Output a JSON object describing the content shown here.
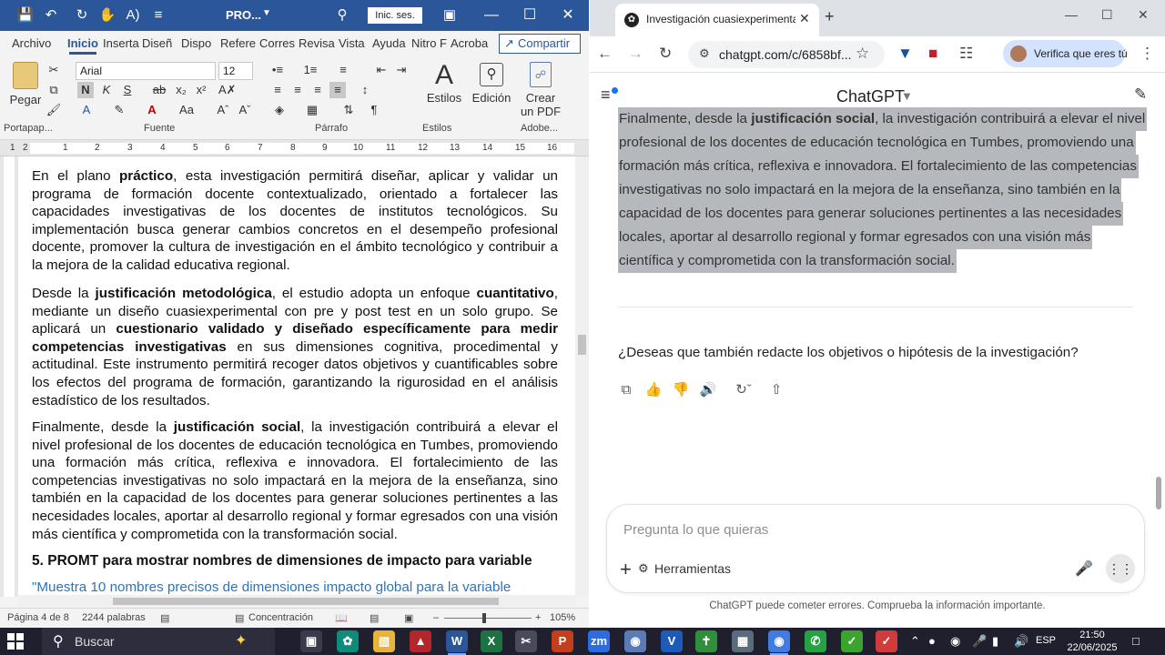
{
  "word": {
    "titlebar": {
      "doc_title": "PRO...",
      "signin_label": "Inic. ses."
    },
    "tabs": [
      "Archivo",
      "Inicio",
      "Inserta",
      "Diseñ",
      "Dispo",
      "Refere",
      "Corres",
      "Revisa",
      "Vista",
      "Ayuda",
      "Nitro F",
      "Acroba"
    ],
    "share_label": "Compartir",
    "ribbon": {
      "paste_label": "Pegar",
      "font_name": "Arial",
      "font_size": "12",
      "bold_glyph": "N",
      "italic_glyph": "K",
      "underline_glyph": "S",
      "styles_label": "Estilos",
      "editing_label": "Edición",
      "pdf_label_1": "Crear",
      "pdf_label_2": "un PDF",
      "groups": {
        "clipboard": "Portapap...",
        "font": "Fuente",
        "paragraph": "Párrafo",
        "styles": "Estilos",
        "adobe": "Adobe..."
      }
    },
    "ruler_numbers": [
      "1",
      "2",
      "1",
      "2",
      "3",
      "4",
      "5",
      "6",
      "7",
      "8",
      "9",
      "10",
      "11",
      "12",
      "13",
      "14",
      "15",
      "16"
    ],
    "document": {
      "p1": "En el plano <b>práctico</b>, esta investigación permitirá diseñar, aplicar y validar un programa de formación docente contextualizado, orientado a fortalecer las capacidades investigativas de los docentes de institutos tecnológicos. Su implementación busca generar cambios concretos en el desempeño profesional docente, promover la cultura de investigación en el ámbito tecnológico y contribuir a la mejora de la calidad educativa regional.",
      "p2": "Desde la <b>justificación metodológica</b>, el estudio adopta un enfoque <b>cuantitativo</b>, mediante un diseño cuasiexperimental con pre y post test en un solo grupo. Se aplicará un <b>cuestionario validado y diseñado específicamente para medir competencias investigativas</b> en sus dimensiones cognitiva, procedimental y actitudinal. Este instrumento permitirá recoger datos objetivos y cuantificables sobre los efectos del programa de formación, garantizando la rigurosidad en el análisis estadístico de los resultados.",
      "p3": "Finalmente, desde la <b>justificación social</b>, la investigación contribuirá a elevar el nivel profesional de los docentes de educación tecnológica en Tumbes, promoviendo una formación más crítica, reflexiva e innovadora. El fortalecimiento de las competencias investigativas no solo impactará en la mejora de la enseñanza, sino también en la capacidad de los docentes para generar soluciones pertinentes a las necesidades locales, aportar al desarrollo regional y formar egresados con una visión más científica y comprometida con la transformación social.",
      "heading": "5. PROMT para mostrar nombres de dimensiones de impacto para variable",
      "quote": "\"Muestra 10 nombres precisos de dimensiones impacto global para la variable"
    },
    "statusbar": {
      "page": "Página 4 de 8",
      "words": "2244 palabras",
      "focus": "Concentración",
      "zoom": "105%"
    }
  },
  "chrome": {
    "tab_title": "Investigación cuasiexperimenta",
    "url": "chatgpt.com/c/6858bf...",
    "verify_label": "Verifica que eres tú",
    "app_title": "ChatGPT",
    "selected_lines": [
      "Finalmente, desde la <b>justificación social</b>, la investigación contribuirá a elevar el nivel",
      "profesional de los docentes de educación tecnológica en Tumbes, promoviendo una",
      "formación más crítica, reflexiva e innovadora. El fortalecimiento de las competencias",
      "investigativas no solo impactará en la mejora de la enseñanza, sino también en la",
      "capacidad de los docentes para generar soluciones pertinentes a las necesidades",
      "locales, aportar al desarrollo regional y formar egresados con una visión más",
      "científica y comprometida con la transformación social."
    ],
    "question": "¿Deseas que también redacte los objetivos o hipótesis de la investigación?",
    "composer": {
      "placeholder": "Pregunta lo que quieras",
      "tools_label": "Herramientas"
    },
    "disclaimer": "ChatGPT puede cometer errores. Comprueba la información importante."
  },
  "taskbar": {
    "search_label": "Buscar",
    "lang": "ESP",
    "time": "21:50",
    "date": "22/06/2025"
  },
  "colors": {
    "word_blue": "#2b579a",
    "selection_gray": "#b5b8bd",
    "quote_blue": "#2e74b5",
    "taskbar_bg": "#1f1f2e"
  }
}
